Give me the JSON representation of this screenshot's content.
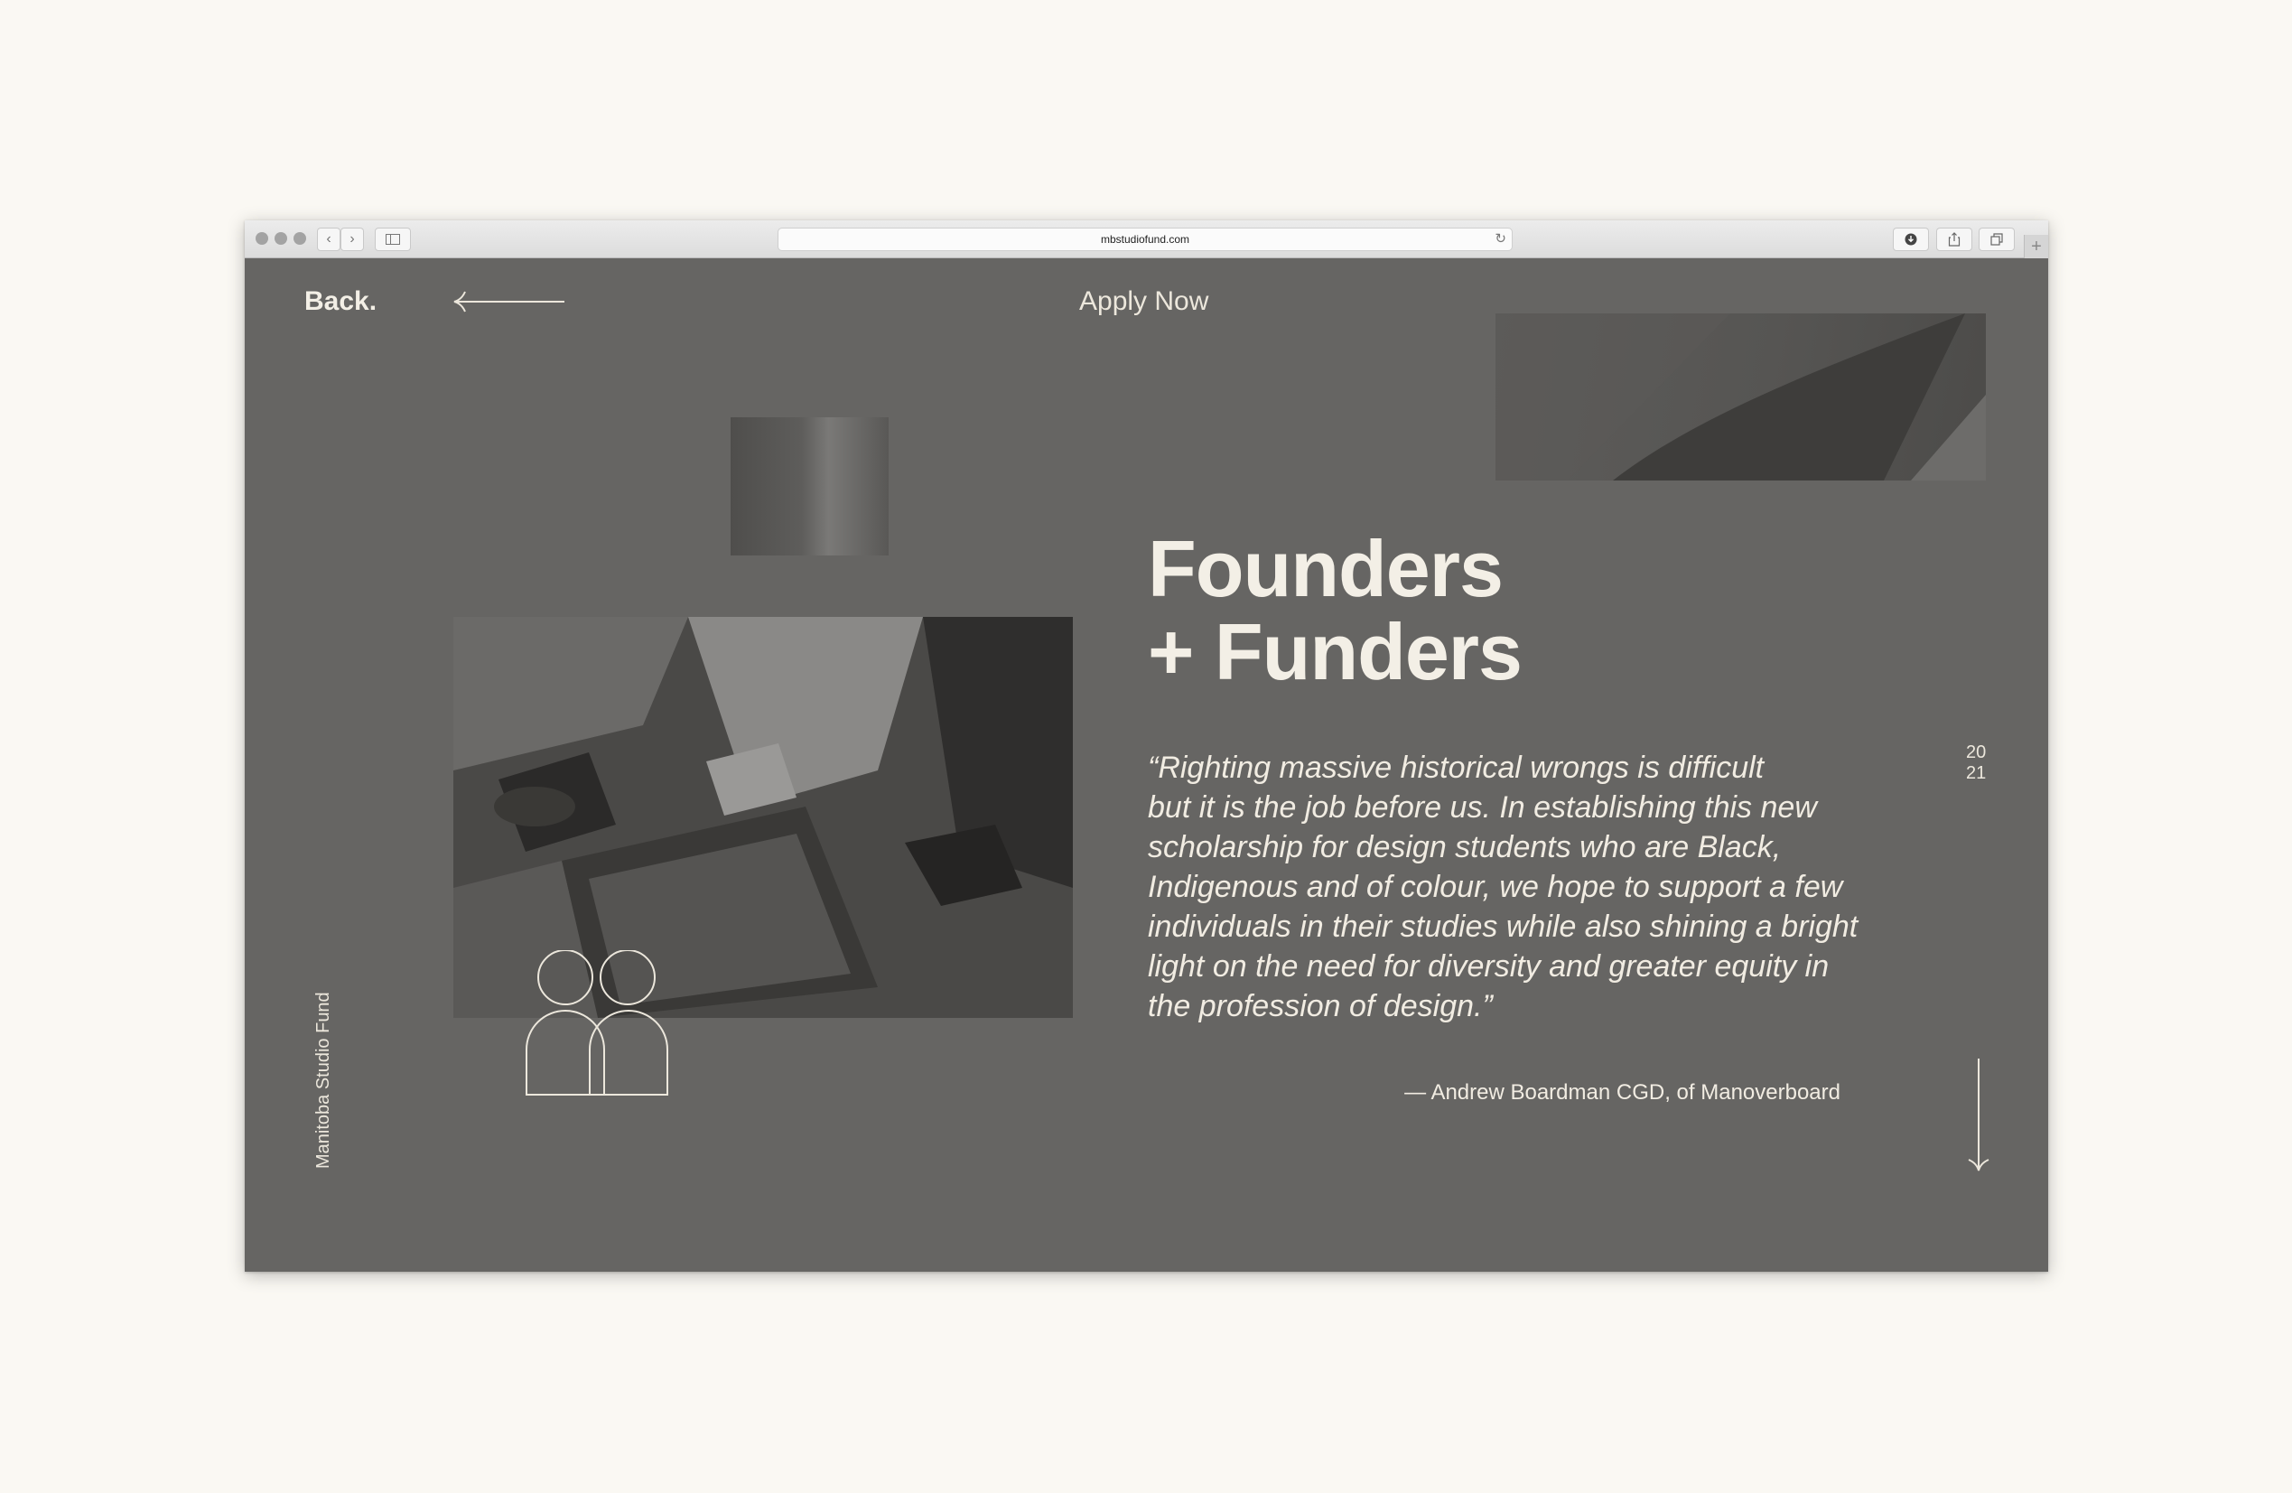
{
  "browser": {
    "url": "mbstudiofund.com",
    "back_glyph": "‹",
    "forward_glyph": "›",
    "reload_glyph": "↻",
    "new_tab_glyph": "+"
  },
  "nav": {
    "back_label": "Back.",
    "apply_label": "Apply Now"
  },
  "hero": {
    "title_line1": "Founders",
    "title_line2": "+ Funders",
    "quote_lines": [
      "“Righting massive historical wrongs is difficult",
      "but it is the job before us. In establishing this new",
      "scholarship for design students who are Black,",
      "Indigenous and of colour, we hope to support a few",
      "individuals in their studies while also shining a bright",
      "light on the need for diversity and greater equity in",
      "the profession of design.”"
    ],
    "attribution": "— Andrew Boardman CGD, of Manoverboard"
  },
  "side": {
    "year_top": "20",
    "year_bottom": "21",
    "vertical_label": "Manitoba Studio Fund"
  },
  "colors": {
    "page_bg": "#faf8f3",
    "site_bg": "#666563",
    "text_light": "#f3efe6"
  },
  "icons": [
    "arrow-left-icon",
    "arrow-down-icon",
    "people-icon",
    "reload-icon",
    "sidebar-icon",
    "download-icon",
    "share-icon",
    "tabs-icon"
  ]
}
